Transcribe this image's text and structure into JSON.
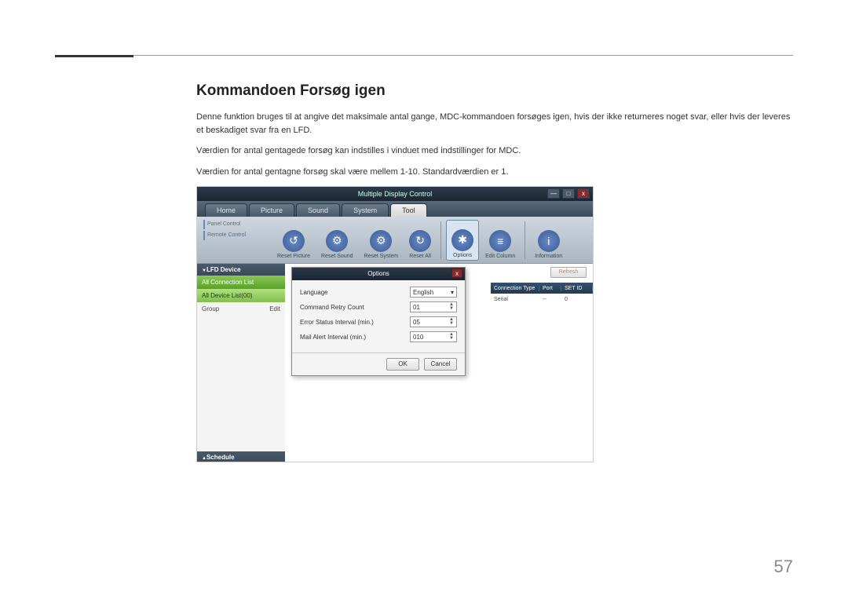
{
  "section": {
    "title": "Kommandoen Forsøg igen",
    "p1": "Denne funktion bruges til at angive det maksimale antal gange, MDC-kommandoen forsøges igen, hvis der ikke returneres noget svar, eller hvis der leveres et beskadiget svar fra en LFD.",
    "p2": "Værdien for antal gentagede forsøg kan indstilles i vinduet med indstillinger for MDC.",
    "p3": "Værdien for antal gentagne forsøg skal være mellem 1-10. Standardværdien er 1."
  },
  "page_number": "57",
  "app": {
    "title": "Multiple Display Control",
    "win": {
      "min": "—",
      "max": "□",
      "close": "x"
    },
    "tabs": [
      "Home",
      "Picture",
      "Sound",
      "System",
      "Tool"
    ],
    "active_tab_index": 4,
    "side_groups": [
      "Panel Control",
      "Remote Control"
    ],
    "toolbar": {
      "items": [
        "Reset Picture",
        "Reset Sound",
        "Reset System",
        "Reset All",
        "Options",
        "Edit Column",
        "Information"
      ],
      "selected_index": 4
    },
    "sidebar": {
      "header": "LFD Device",
      "all_conn": "All Connection List",
      "all_dev": "All Device List(00)",
      "group_label": "Group",
      "edit_label": "Edit",
      "footer": "Schedule"
    },
    "list": {
      "refresh": "Refresh",
      "columns": [
        "Connection Type",
        "Port",
        "SET ID"
      ],
      "row": [
        "Serial",
        "--",
        "0"
      ]
    },
    "dialog": {
      "title": "Options",
      "rows": [
        {
          "label": "Language",
          "value": "English",
          "type": "dropdown"
        },
        {
          "label": "Command Retry Count",
          "value": "01",
          "type": "spinner"
        },
        {
          "label": "Error Status Interval (min.)",
          "value": "05",
          "type": "spinner"
        },
        {
          "label": "Mail Alert Interval (min.)",
          "value": "010",
          "type": "spinner"
        }
      ],
      "ok": "OK",
      "cancel": "Cancel"
    }
  }
}
